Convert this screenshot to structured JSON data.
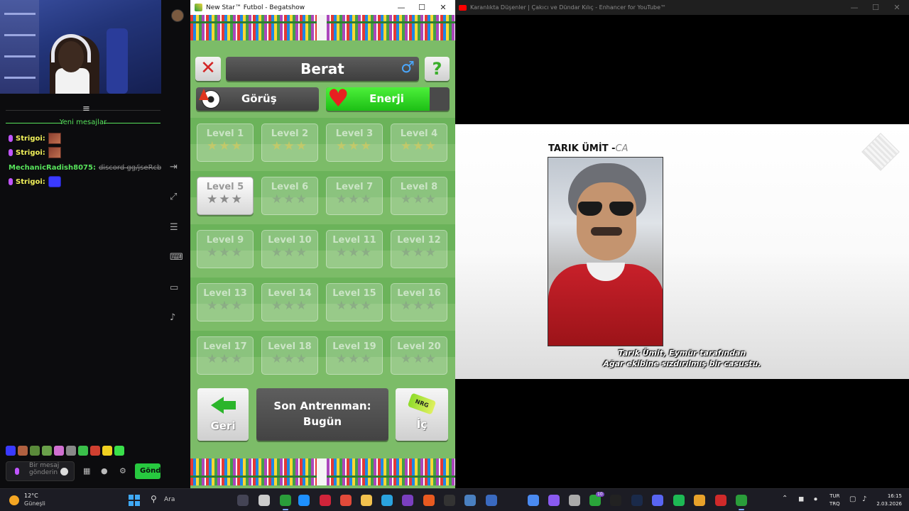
{
  "chat": {
    "new_messages_label": "Yeni mesajlar",
    "messages": [
      {
        "user": "Strigoi:",
        "text": ""
      },
      {
        "user": "Strigoi:",
        "text": ""
      },
      {
        "user": "MechanicRadish8075:",
        "text": "discord gg/jseRcbTk (Silindi"
      },
      {
        "user": "Strigoi:",
        "text": ""
      }
    ],
    "input_placeholder": "Bir mesaj gönderin",
    "send_label": "Gönde"
  },
  "game": {
    "window_title": "New Star™ Futbol - Begatshow",
    "player_name": "Berat",
    "vision_label": "Görüş",
    "energy_label": "Enerji",
    "energy_level": 0.84,
    "levels": [
      {
        "name": "Level 1",
        "stars": "★★★",
        "state": "locked"
      },
      {
        "name": "Level 2",
        "stars": "★★★",
        "state": "locked"
      },
      {
        "name": "Level 3",
        "stars": "★★★",
        "state": "locked"
      },
      {
        "name": "Level 4",
        "stars": "★★★",
        "state": "locked"
      },
      {
        "name": "Level 5",
        "stars": "★★★",
        "state": "unlocked"
      },
      {
        "name": "Level 6",
        "stars": "★★★",
        "state": "grey"
      },
      {
        "name": "Level 7",
        "stars": "★★★",
        "state": "grey"
      },
      {
        "name": "Level 8",
        "stars": "★★★",
        "state": "grey"
      },
      {
        "name": "Level 9",
        "stars": "★★★",
        "state": "grey"
      },
      {
        "name": "Level 10",
        "stars": "★★★",
        "state": "grey"
      },
      {
        "name": "Level 11",
        "stars": "★★★",
        "state": "grey"
      },
      {
        "name": "Level 12",
        "stars": "★★★",
        "state": "grey"
      },
      {
        "name": "Level 13",
        "stars": "★★★",
        "state": "grey"
      },
      {
        "name": "Level 14",
        "stars": "★★★",
        "state": "grey"
      },
      {
        "name": "Level 15",
        "stars": "★★★",
        "state": "grey"
      },
      {
        "name": "Level 16",
        "stars": "★★★",
        "state": "grey"
      },
      {
        "name": "Level 17",
        "stars": "★★★",
        "state": "grey"
      },
      {
        "name": "Level 18",
        "stars": "★★★",
        "state": "grey"
      },
      {
        "name": "Level 19",
        "stars": "★★★",
        "state": "grey"
      },
      {
        "name": "Level 20",
        "stars": "★★★",
        "state": "grey"
      }
    ],
    "back_label": "Geri",
    "last_training_line1": "Son Antrenman:",
    "last_training_line2": "Bugün",
    "drink_label": "İç",
    "can_text": "NRG"
  },
  "browser": {
    "window_title": "Karanlıkta Düşenler | Çakıcı ve Dündar Kılıç - Enhancer for YouTube™",
    "video_name": "TARIK ÜMİT -",
    "video_name_suffix": "CA",
    "subtitle_line1": "Tarık Ümit, Eymür tarafından",
    "subtitle_line2": "Ağar ekibine sızdırılmış bir casustu."
  },
  "taskbar": {
    "temperature": "12°C",
    "weather": "Güneşli",
    "search_label": "Ara",
    "lang_top": "TUR",
    "lang_bottom": "TRQ",
    "time": "16:15",
    "date": "2.03.2026",
    "badge_count": "10"
  },
  "colors": {
    "accent_green": "#57e35b",
    "energy_green": "#1dbf15",
    "youtube_red": "#ff0000"
  }
}
